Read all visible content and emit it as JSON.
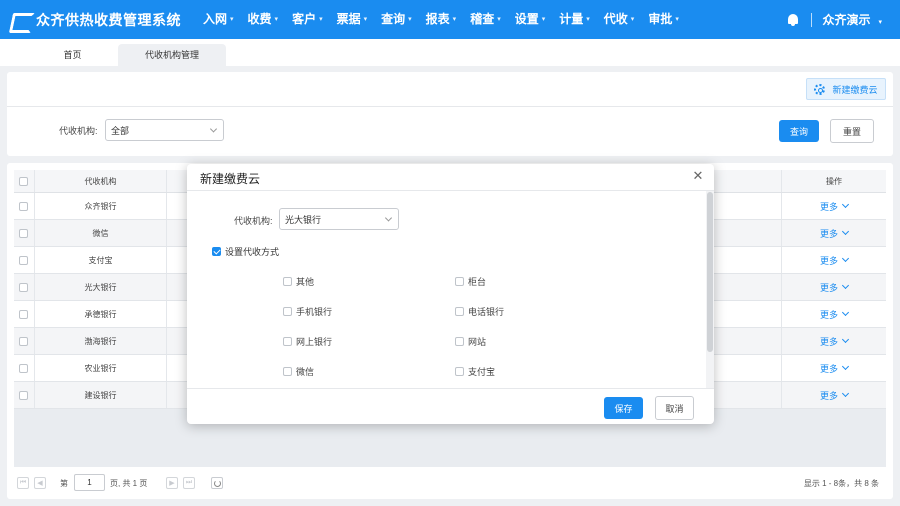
{
  "app": {
    "title": "众齐供热收费管理系统",
    "user": "众齐演示"
  },
  "nav": [
    {
      "label": "入网"
    },
    {
      "label": "收费"
    },
    {
      "label": "客户"
    },
    {
      "label": "票据"
    },
    {
      "label": "查询"
    },
    {
      "label": "报表"
    },
    {
      "label": "稽查"
    },
    {
      "label": "设置"
    },
    {
      "label": "计量"
    },
    {
      "label": "代收"
    },
    {
      "label": "审批"
    }
  ],
  "tabs": {
    "home": "首页",
    "active": "代收机构管理"
  },
  "toolbar": {
    "new_label": "新建缴费云"
  },
  "filter": {
    "label": "代收机构:",
    "value": "全部",
    "search_label": "查询",
    "reset_label": "重置"
  },
  "table": {
    "col_org": "代收机构",
    "col_op": "操作",
    "more_label": "更多",
    "rows": [
      {
        "org": "众齐银行"
      },
      {
        "org": "微信"
      },
      {
        "org": "支付宝"
      },
      {
        "org": "光大银行"
      },
      {
        "org": "承德银行"
      },
      {
        "org": "渤海银行"
      },
      {
        "org": "农业银行"
      },
      {
        "org": "建设银行"
      }
    ]
  },
  "pager": {
    "prefix": "第",
    "page": "1",
    "suffix": "页, 共 1 页",
    "summary": "显示 1 - 8条，共 8 条",
    "first": "⏮",
    "prev": "◀",
    "next": "▶",
    "last": "⏭"
  },
  "dialog": {
    "title": "新建缴费云",
    "close": "✕",
    "org_label": "代收机构:",
    "org_value": "光大银行",
    "set_methods_label": "设置代收方式",
    "set_methods_checked": true,
    "options": [
      {
        "label": "其他",
        "checked": false
      },
      {
        "label": "柜台",
        "checked": false
      },
      {
        "label": "手机银行",
        "checked": false
      },
      {
        "label": "电话银行",
        "checked": false
      },
      {
        "label": "网上银行",
        "checked": false
      },
      {
        "label": "网站",
        "checked": false
      },
      {
        "label": "微信",
        "checked": false
      },
      {
        "label": "支付宝",
        "checked": false
      }
    ],
    "save_label": "保存",
    "cancel_label": "取消"
  },
  "colors": {
    "primary": "#1a8cf0",
    "page_bg": "#eef0f3"
  }
}
